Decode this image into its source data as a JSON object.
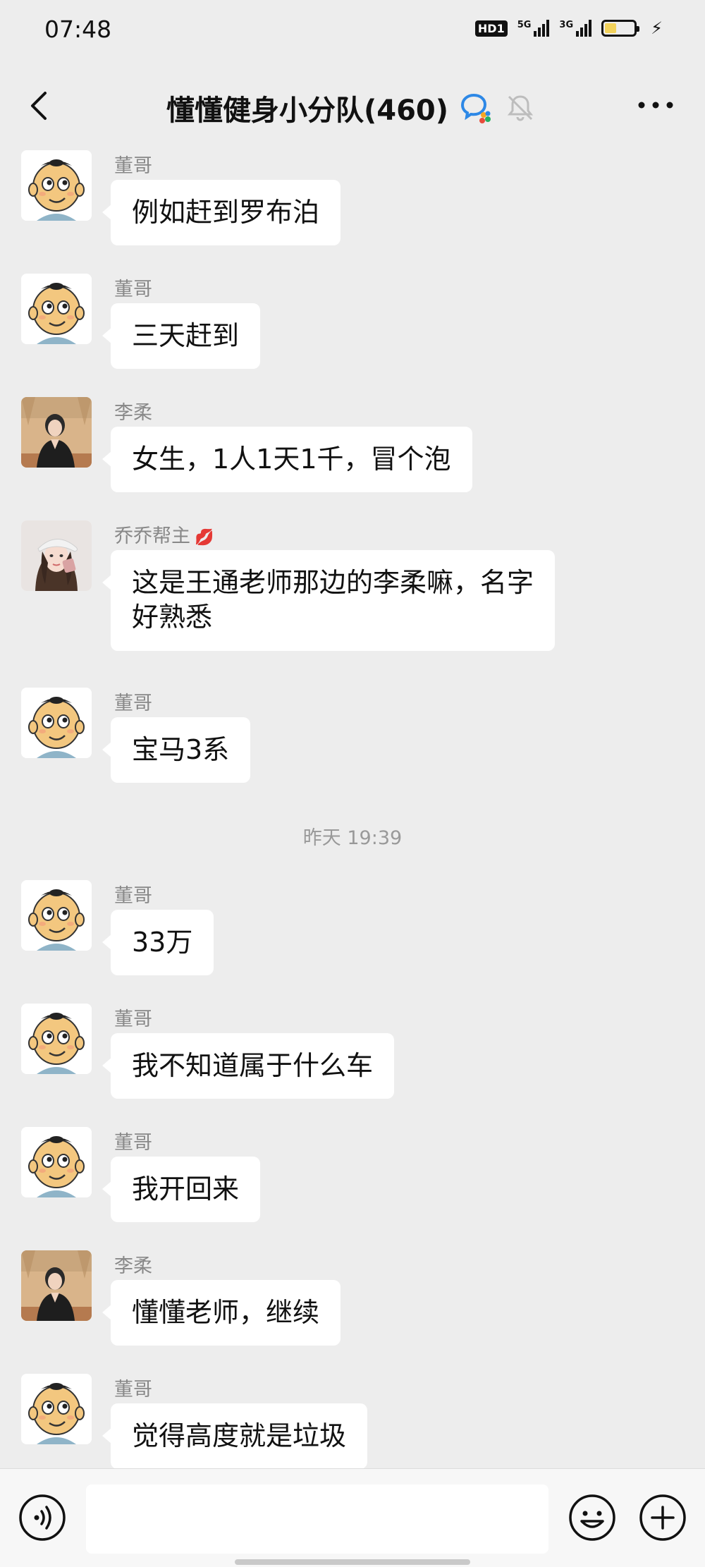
{
  "status_bar": {
    "time": "07:48",
    "hd": "HD1",
    "net1": "5G",
    "net2": "3G",
    "battery_level": 0.4
  },
  "nav": {
    "title": "懂懂健身小分队(460)"
  },
  "messages": [
    {
      "sender": "董哥",
      "text": "例如赶到罗布泊",
      "avatar": "cartoon-boy"
    },
    {
      "sender": "董哥",
      "text": "三天赶到",
      "avatar": "cartoon-boy"
    },
    {
      "sender": "李柔",
      "text": "女生，1人1天1千，冒个泡",
      "avatar": "woman-photo"
    },
    {
      "sender": "乔乔帮主",
      "text": "这是王通老师那边的李柔嘛，名字好熟悉",
      "avatar": "girl-cap-photo",
      "badge_icon": "lips-icon"
    },
    {
      "sender": "董哥",
      "text": "宝马3系",
      "avatar": "cartoon-boy"
    },
    {
      "sender": "董哥",
      "text": "33万",
      "avatar": "cartoon-boy"
    },
    {
      "sender": "董哥",
      "text": "我不知道属于什么车",
      "avatar": "cartoon-boy"
    },
    {
      "sender": "董哥",
      "text": "我开回来",
      "avatar": "cartoon-boy"
    },
    {
      "sender": "李柔",
      "text": "懂懂老师，继续",
      "avatar": "woman-photo"
    },
    {
      "sender": "董哥",
      "text": "觉得高度就是垃圾",
      "avatar": "cartoon-boy"
    }
  ],
  "time_separator": "昨天 19:39",
  "input": {
    "value": "",
    "placeholder": ""
  },
  "colors": {
    "background": "#ededed",
    "bubble": "#ffffff",
    "sender_text": "#888888"
  }
}
